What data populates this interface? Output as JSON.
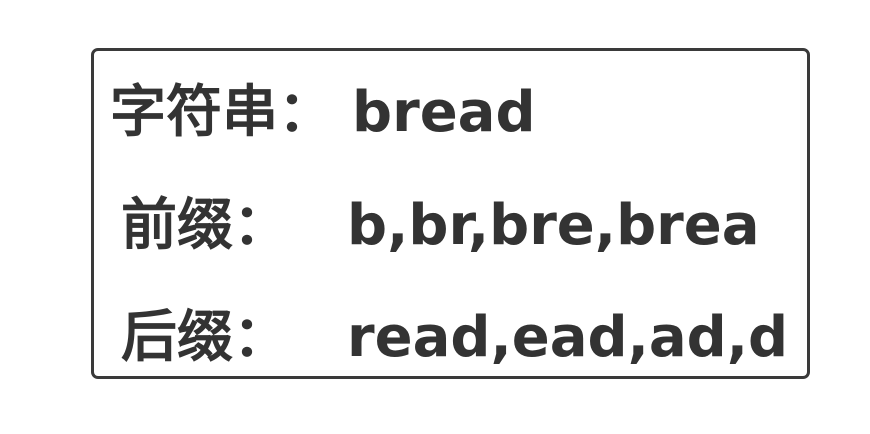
{
  "rows": [
    {
      "label": "字符串：",
      "value": "bread"
    },
    {
      "label": "前缀：",
      "value": "b,br,bre,brea"
    },
    {
      "label": "后缀：",
      "value": "read,ead,ad,d"
    }
  ],
  "colors": {
    "text": "#333333",
    "border": "#3a3a3a",
    "background": "#ffffff"
  }
}
